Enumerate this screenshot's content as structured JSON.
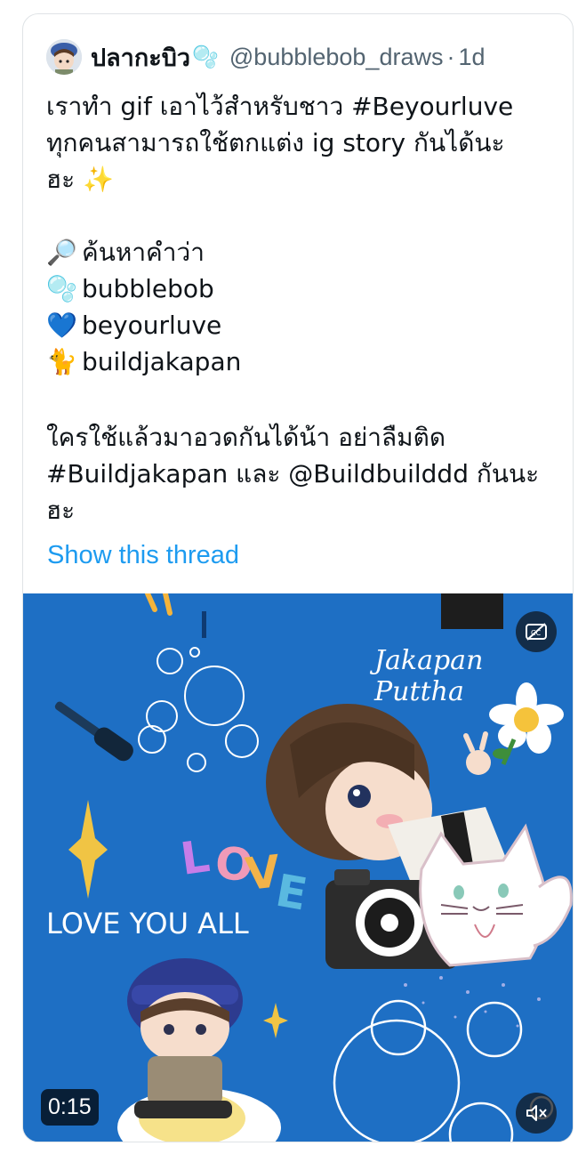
{
  "tweet": {
    "author_name": "ปลากะบิว",
    "author_name_emoji": "🫧",
    "handle": "@bubblebob_draws",
    "separator": "·",
    "time": "1d",
    "paragraph1": [
      "เราทำ gif เอาไว้สำหรับชาว #Beyourluve",
      "ทุกคนสามารถใช้ตกแต่ง ig story กันได้นะ",
      "ฮะ ✨"
    ],
    "search_list": [
      {
        "emoji": "🔎",
        "text": "ค้นหาคำว่า"
      },
      {
        "emoji": "🫧",
        "text": "bubblebob"
      },
      {
        "emoji": "💙",
        "text": "beyourluve"
      },
      {
        "emoji": "🐈",
        "text": "buildjakapan"
      }
    ],
    "paragraph2": [
      "ใครใช้แล้วมาอวดกันได้น้า อย่าลืมติด",
      "#Buildjakapan และ @Buildbuilddd กันนะ",
      "ฮะ"
    ],
    "show_thread": "Show this thread"
  },
  "media": {
    "duration": "0:15",
    "overlay_text_top": "Jakapan Puttha",
    "overlay_text_left": "LOVE YOU ALL",
    "overlay_love": "LOVE",
    "captions_icon": "closed-captions-off-icon",
    "mute_icon": "speaker-muted-icon",
    "background_color": "#1e6fc4"
  }
}
